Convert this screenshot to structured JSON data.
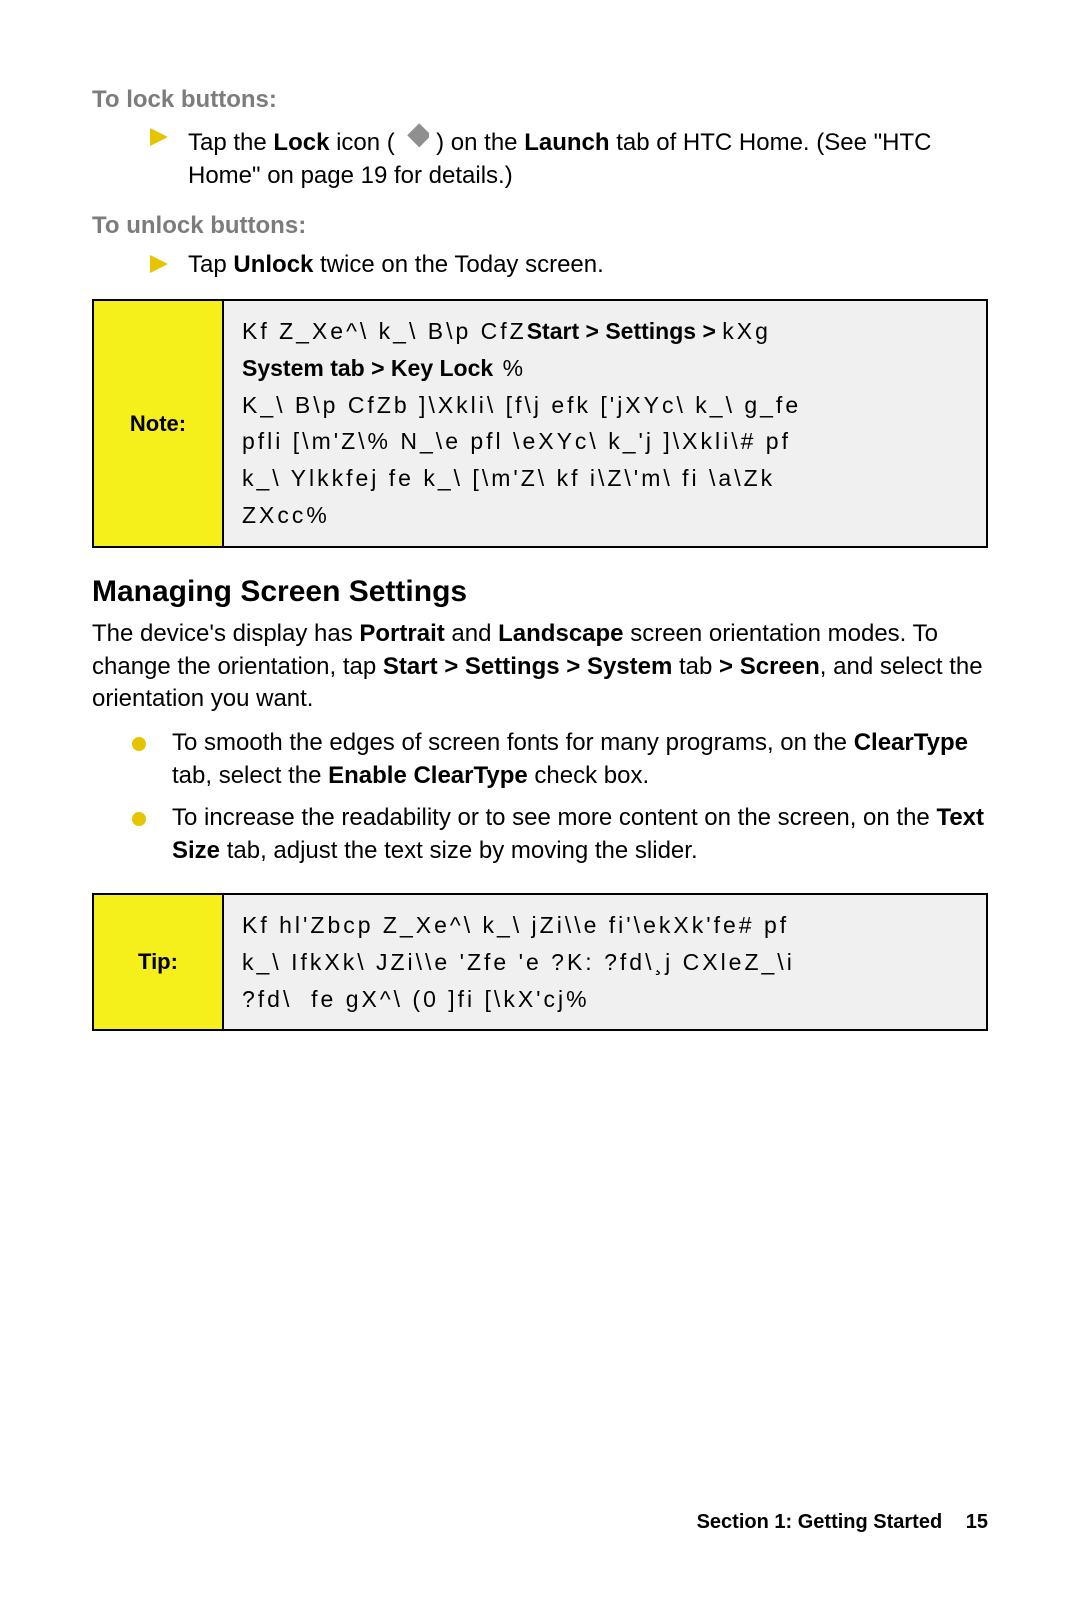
{
  "section_lock_heading": "To lock buttons:",
  "section_unlock_heading": "To unlock buttons:",
  "lock_item": {
    "pre": "Tap the ",
    "bold1": "Lock",
    "mid1": " icon ( ",
    "mid2": " ) on the ",
    "bold2": "Launch",
    "post": " tab of HTC Home. (See \"HTC Home\" on page 19 for details.)"
  },
  "unlock_item": {
    "pre": "Tap ",
    "bold1": "Unlock",
    "post": " twice on the Today screen."
  },
  "note_label": "Note:",
  "note_body_line1_pre": "Kf Z_Xe^\\ k_\\ B\\p CfZ",
  "note_body_line1_nav": "Start > Settings > ",
  "note_body_line1_post": "kXg ",
  "note_body_line2_nav": "System tab > Key Lock",
  "note_body_line2_post": " %",
  "note_body_rest": "K_\\ B\\p CfZb ]\\Xkli\\ [f\\j efk ['jXYc\\ k_\\ g_fe\npfli [\\m'Z\\% N_\\e pfl \\eXYc\\ k_'j ]\\Xkli\\# pf\nk_\\ Ylkkfej fe k_\\ [\\m'Z\\ kf i\\Z\\'m\\ fi \\a\\Zk\nZXcc%",
  "h2": "Managing Screen Settings",
  "para": {
    "t1": "The device's display has ",
    "b1": "Portrait",
    "t2": " and ",
    "b2": "Landscape",
    "t3": " screen orientation modes. To change the orientation, tap ",
    "b3": "Start > Settings > System",
    "t4": " tab ",
    "b4": "> Screen",
    "t5": ", and select the orientation you want."
  },
  "bullet1": {
    "t1": "To smooth the edges of screen fonts for many programs, on the ",
    "b1": "ClearType",
    "t2": " tab, select the ",
    "b2": "Enable ClearType",
    "t3": " check box."
  },
  "bullet2": {
    "t1": "To increase the readability or to see more content on the screen, on the ",
    "b1": "Text Size",
    "t2": " tab, adjust the text size by moving the slider."
  },
  "tip_label": "Tip:",
  "tip_body": "Kf hl'Zbcp Z_Xe^\\ k_\\ jZi\\\\e fi'\\ekXk'fe# pf\nk_\\ IfkXk\\ JZi\\\\e 'Zfe 'e ?K: ?fd\\¸j CXleZ_\\i\n?fd\\  fe gX^\\ (0 ]fi [\\kX'cj%",
  "footer_section": "Section 1: Getting Started",
  "footer_page": "15"
}
